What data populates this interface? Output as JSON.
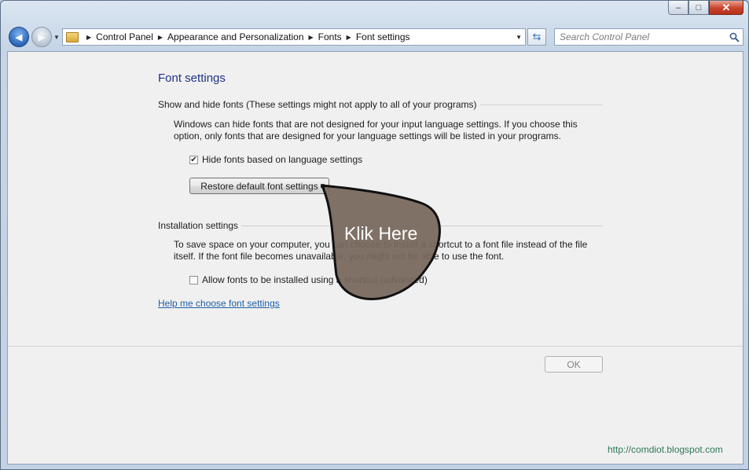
{
  "window": {
    "minimize_glyph": "–",
    "maximize_glyph": "□",
    "close_glyph": "✕"
  },
  "nav": {
    "back_glyph": "◀",
    "forward_glyph": "▶",
    "breadcrumb": [
      "Control Panel",
      "Appearance and Personalization",
      "Fonts",
      "Font settings"
    ],
    "search_placeholder": "Search Control Panel"
  },
  "page": {
    "title": "Font settings",
    "show_hide": {
      "header": "Show and hide fonts (These settings might not apply to all of your programs)",
      "description_line1": "Windows can hide fonts that are not designed for your input language settings. If you choose this",
      "description_line2": "option, only fonts that are designed for your language settings will be listed in your programs.",
      "checkbox_label": "Hide fonts based on language settings",
      "checkbox_checked": true,
      "restore_button": "Restore default font settings"
    },
    "installation": {
      "header": "Installation settings",
      "description_line1": "To save space on your computer, you can choose to install a shortcut to a font file instead of the file",
      "description_line2": "itself. If the font file becomes unavailable, you might not be able to use the font.",
      "checkbox_label": "Allow fonts to be installed using a shortcut (advanced)",
      "checkbox_checked": false
    },
    "help_link": "Help me choose font settings",
    "ok_button": "OK"
  },
  "overlay": {
    "callout_text": "Klik Here",
    "watermark": "http://comdiot.blogspot.com"
  },
  "colors": {
    "title": "#1e3287",
    "link": "#1f5fa8",
    "callout_fill": "#77675d",
    "watermark": "#2f7a55"
  }
}
